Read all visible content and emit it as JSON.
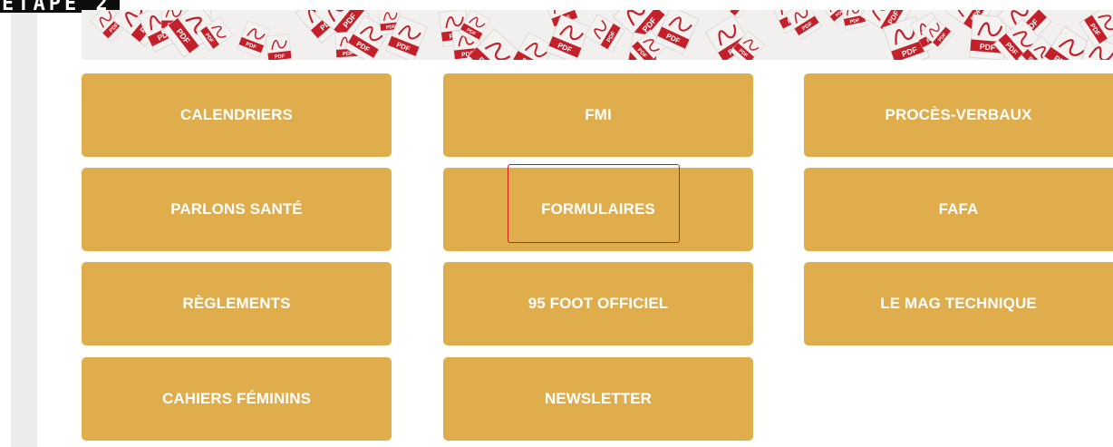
{
  "step_label": "ETAPE 2",
  "banner": {
    "icon_name": "pdf-icon",
    "icon_text": "PDF",
    "colors": {
      "red": "#c3202a",
      "paper": "#f4f2f1"
    }
  },
  "tiles": {
    "calendriers": "CALENDRIERS",
    "fmi": "FMI",
    "proces_verbaux": "PROCÈS-VERBAUX",
    "parlons_sante": "PARLONS SANTÉ",
    "formulaires": "FORMULAIRES",
    "fafa": "FAFA",
    "reglements": "RÈGLEMENTS",
    "foot_officiel": "95 FOOT OFFICIEL",
    "mag_technique": "LE MAG TECHNIQUE",
    "cahiers_feminins": "CAHIERS FÉMININS",
    "newsletter": "NEWSLETTER"
  },
  "colors": {
    "tile_background": "#dfad4c",
    "tile_text": "#ffffff",
    "highlight": "#d11b1b",
    "sidebar": "#ececec"
  }
}
